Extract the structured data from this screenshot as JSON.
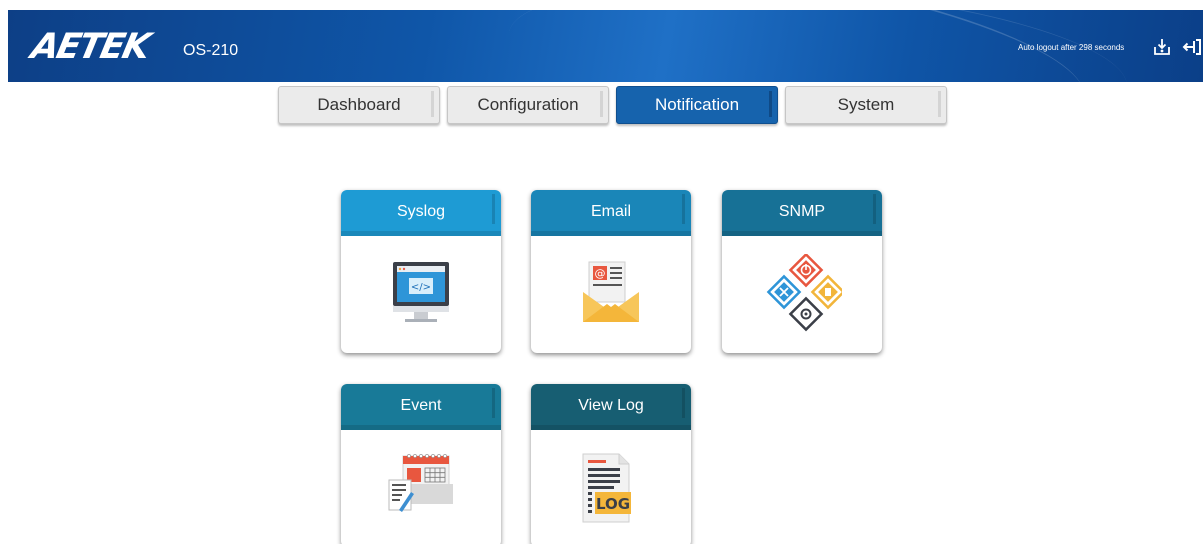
{
  "header": {
    "logo": "AETEK",
    "model": "OS-210",
    "auto_logout": "Auto logout after 298 seconds",
    "icons": [
      "save-config-icon",
      "logout-icon"
    ]
  },
  "tabs": [
    {
      "label": "Dashboard",
      "active": false
    },
    {
      "label": "Configuration",
      "active": false
    },
    {
      "label": "Notification",
      "active": true
    },
    {
      "label": "System",
      "active": false
    }
  ],
  "tiles": [
    {
      "label": "Syslog",
      "icon": "monitor-code-icon",
      "color": "#1e9bd4"
    },
    {
      "label": "Email",
      "icon": "email-envelope-icon",
      "color": "#1a86b8"
    },
    {
      "label": "SNMP",
      "icon": "snmp-network-icon",
      "color": "#177196"
    },
    {
      "label": "Event",
      "icon": "event-calendar-icon",
      "color": "#187a98"
    },
    {
      "label": "View Log",
      "icon": "log-document-icon",
      "color": "#175e72"
    }
  ],
  "colors": {
    "header_blue": "#0f56a8",
    "active_tab": "#1663ad",
    "tab_gray": "#ebebeb"
  }
}
